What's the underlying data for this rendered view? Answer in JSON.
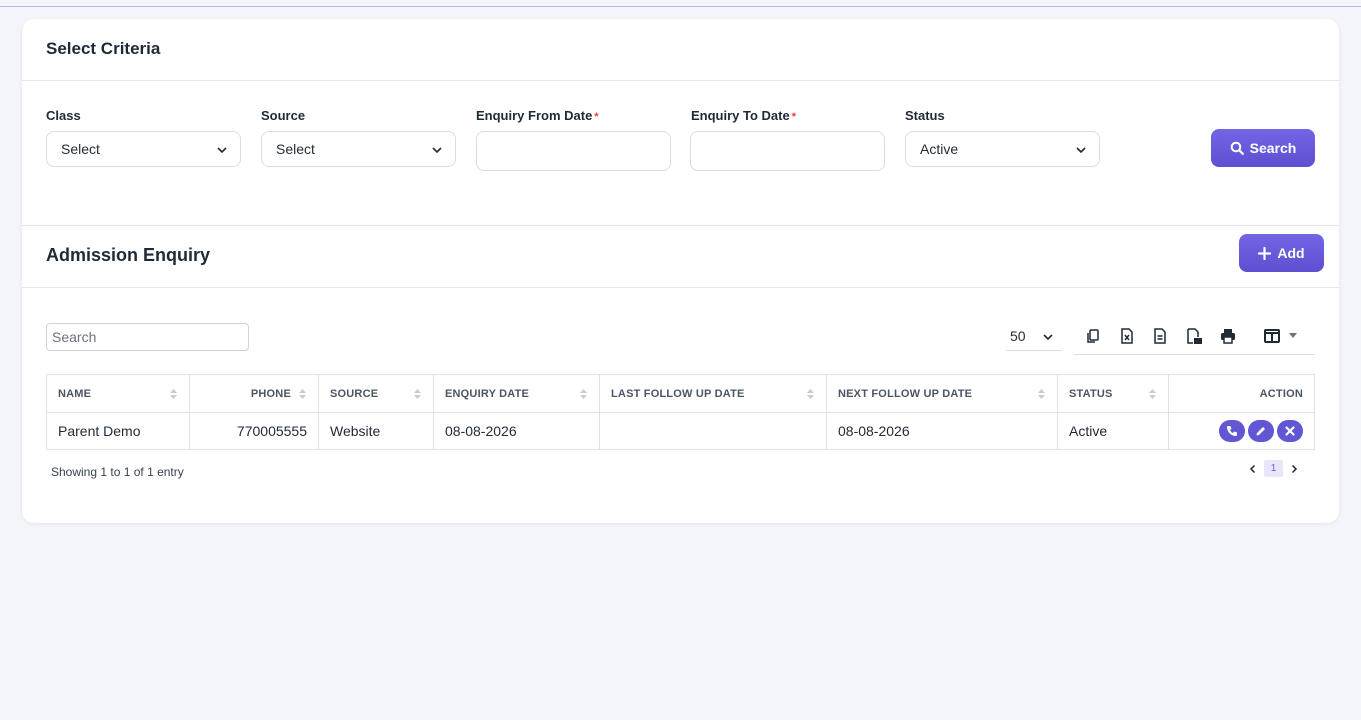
{
  "criteria": {
    "title": "Select Criteria",
    "class_label": "Class",
    "class_value": "Select",
    "source_label": "Source",
    "source_value": "Select",
    "from_label": "Enquiry From Date",
    "to_label": "Enquiry To Date",
    "required_mark": "*",
    "status_label": "Status",
    "status_value": "Active",
    "search_button": "Search"
  },
  "enquiry": {
    "title": "Admission Enquiry",
    "add_button": "Add",
    "search_placeholder": "Search",
    "page_size": "50",
    "columns": [
      "NAME",
      "PHONE",
      "SOURCE",
      "ENQUIRY DATE",
      "LAST FOLLOW UP DATE",
      "NEXT FOLLOW UP DATE",
      "STATUS",
      "ACTION"
    ],
    "rows": [
      {
        "name": "Parent Demo",
        "phone": "770005555",
        "source": "Website",
        "enquiry_date": "08-08-2026",
        "last_follow_up": "",
        "next_follow_up": "08-08-2026",
        "status": "Active"
      }
    ],
    "info": "Showing 1 to 1 of 1 entry",
    "current_page": "1"
  },
  "colors": {
    "accent": "#6c5dd3",
    "required": "#e53e3e",
    "background": "#f4f5fa"
  }
}
